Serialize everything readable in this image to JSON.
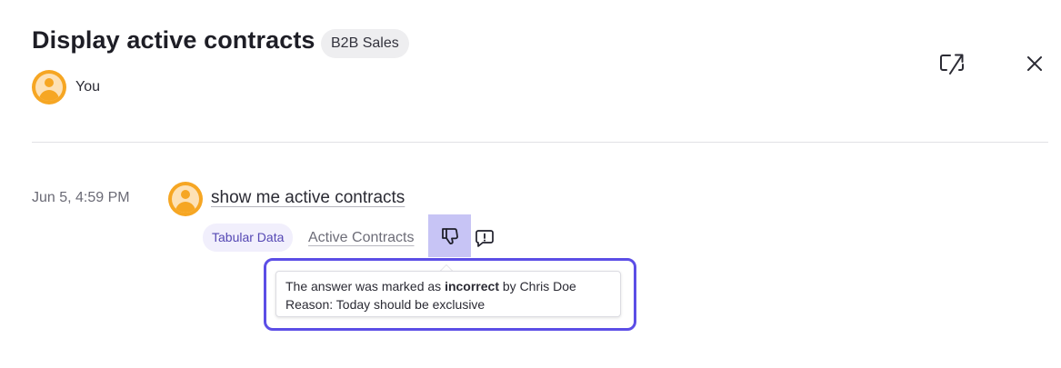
{
  "header": {
    "title": "Display active contracts",
    "tag": "B2B Sales",
    "owner": "You"
  },
  "icons": {
    "open": "open-external-icon",
    "close": "close-icon",
    "thumbs_down": "thumbs-down-icon",
    "feedback": "feedback-icon",
    "avatar": "user-avatar-icon"
  },
  "colors": {
    "accent": "#5c4ee6",
    "avatar": "#f6a623",
    "badge_bg": "#f1effc",
    "badge_text": "#5548b4",
    "thumb_bg": "#c7c4f5"
  },
  "message": {
    "timestamp": "Jun 5, 4:59 PM",
    "query": "show me active contracts",
    "answer_type": "Tabular Data",
    "answer_name": "Active Contracts"
  },
  "tooltip": {
    "line1_prefix": "The answer was marked as",
    "line1_bold": "incorrect",
    "line1_suffix": "by Chris Doe",
    "line2": "Reason: Today should be exclusive"
  }
}
